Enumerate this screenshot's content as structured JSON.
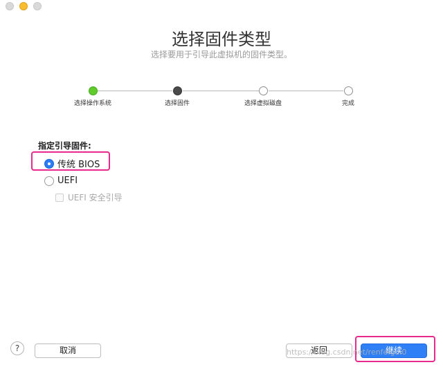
{
  "header": {
    "title": "选择固件类型",
    "subtitle": "选择要用于引导此虚拟机的固件类型。"
  },
  "steps": [
    {
      "label": "选择操作系统",
      "state": "done"
    },
    {
      "label": "选择固件",
      "state": "active"
    },
    {
      "label": "选择虚拟磁盘",
      "state": "todo"
    },
    {
      "label": "完成",
      "state": "todo"
    }
  ],
  "firmware": {
    "section_label": "指定引导固件:",
    "options": [
      {
        "label": "传统 BIOS",
        "selected": true
      },
      {
        "label": "UEFI",
        "selected": false
      }
    ],
    "secure_boot": {
      "label": "UEFI 安全引导",
      "checked": false,
      "enabled": false
    }
  },
  "footer": {
    "help_label": "?",
    "cancel_label": "取消",
    "back_label": "返回",
    "continue_label": "继续"
  },
  "watermark": "https://blog.csdn.net/renfeigui0",
  "colors": {
    "accent": "#2f7ff7",
    "highlight": "#e8288a",
    "step_done": "#5ecb2a",
    "step_active": "#4a4a4a"
  }
}
